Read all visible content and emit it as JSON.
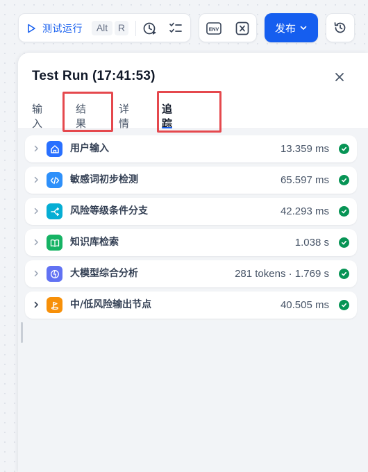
{
  "toolbar": {
    "run_label": "测试运行",
    "shortcut_alt": "Alt",
    "shortcut_r": "R",
    "env_label": "ENV",
    "publish_label": "发布",
    "accent_color": "#155eef"
  },
  "panel": {
    "title": "Test Run (17:41:53)",
    "tabs": [
      {
        "label": "输入",
        "active": false
      },
      {
        "label": "结果",
        "active": false
      },
      {
        "label": "详情",
        "active": false
      },
      {
        "label": "追踪",
        "active": true
      }
    ],
    "nodes": [
      {
        "name": "用户输入",
        "time": "13.359 ms",
        "icon": "home-icon",
        "icon_color": "#2970ff",
        "status": "success"
      },
      {
        "name": "敏感词初步检测",
        "time": "65.597 ms",
        "icon": "code-icon",
        "icon_color": "#2e90fa",
        "status": "success"
      },
      {
        "name": "风险等级条件分支",
        "time": "42.293 ms",
        "icon": "branch-icon",
        "icon_color": "#06aed4",
        "status": "success"
      },
      {
        "name": "知识库检索",
        "time": "1.038 s",
        "icon": "book-icon",
        "icon_color": "#16b364",
        "status": "success"
      },
      {
        "name": "大模型综合分析",
        "time": "281 tokens · 1.769 s",
        "icon": "llm-icon",
        "icon_color": "#6172f3",
        "status": "success"
      },
      {
        "name": "中/低风险输出节点",
        "time": "40.505 ms",
        "icon": "flag-icon",
        "icon_color": "#f79009",
        "status": "success"
      }
    ],
    "status_color": "#079455"
  }
}
